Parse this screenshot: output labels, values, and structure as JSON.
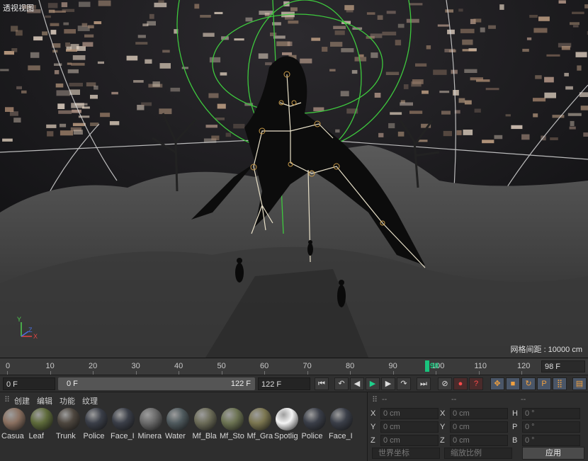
{
  "viewport": {
    "title": "透视视图",
    "grid_spacing": "网格间距 : 10000 cm",
    "axis_labels": {
      "y": "Y",
      "x": "X",
      "z": "Z"
    }
  },
  "timeline": {
    "ticks": [
      "0",
      "10",
      "20",
      "30",
      "40",
      "50",
      "60",
      "70",
      "80",
      "90",
      "100",
      "110",
      "120"
    ],
    "playhead_label": "98",
    "playhead_frame": 98,
    "end_frame": "98 F"
  },
  "transport": {
    "current_frame": "0 F",
    "range_start": "0 F",
    "range_end": "122 F",
    "max_frame": "122 F"
  },
  "materials_menu": [
    "创建",
    "编辑",
    "功能",
    "纹理"
  ],
  "materials": [
    {
      "label": "Casua",
      "color": "#8a7060"
    },
    {
      "label": "Leaf",
      "color": "#5e6b3a"
    },
    {
      "label": "Trunk",
      "color": "#4d463e"
    },
    {
      "label": "Police",
      "color": "#3a3e48"
    },
    {
      "label": "Face_I",
      "color": "#3a3e48"
    },
    {
      "label": "Minera",
      "color": "#6a6a6a"
    },
    {
      "label": "Water",
      "color": "#4f5a5e"
    },
    {
      "label": "Mf_Bla",
      "color": "#6c6c58"
    },
    {
      "label": "Mf_Sto",
      "color": "#6c7352"
    },
    {
      "label": "Mf_Gra",
      "color": "#7b7650"
    },
    {
      "label": "Spotlig",
      "color": "#f4f4f4"
    },
    {
      "label": "Police",
      "color": "#3a3e48"
    },
    {
      "label": "Face_I",
      "color": "#3a3e48"
    }
  ],
  "coords": {
    "headers": [
      "--",
      "--",
      "--"
    ],
    "rows": [
      {
        "a": "X",
        "av": "0 cm",
        "b": "X",
        "bv": "0 cm",
        "c": "H",
        "cv": "0 °"
      },
      {
        "a": "Y",
        "av": "0 cm",
        "b": "Y",
        "bv": "0 cm",
        "c": "P",
        "cv": "0 °"
      },
      {
        "a": "Z",
        "av": "0 cm",
        "b": "Z",
        "bv": "0 cm",
        "c": "B",
        "cv": "0 °"
      }
    ],
    "mode_world": "世界坐标",
    "mode_scale": "缩放比例",
    "apply": "应用"
  }
}
